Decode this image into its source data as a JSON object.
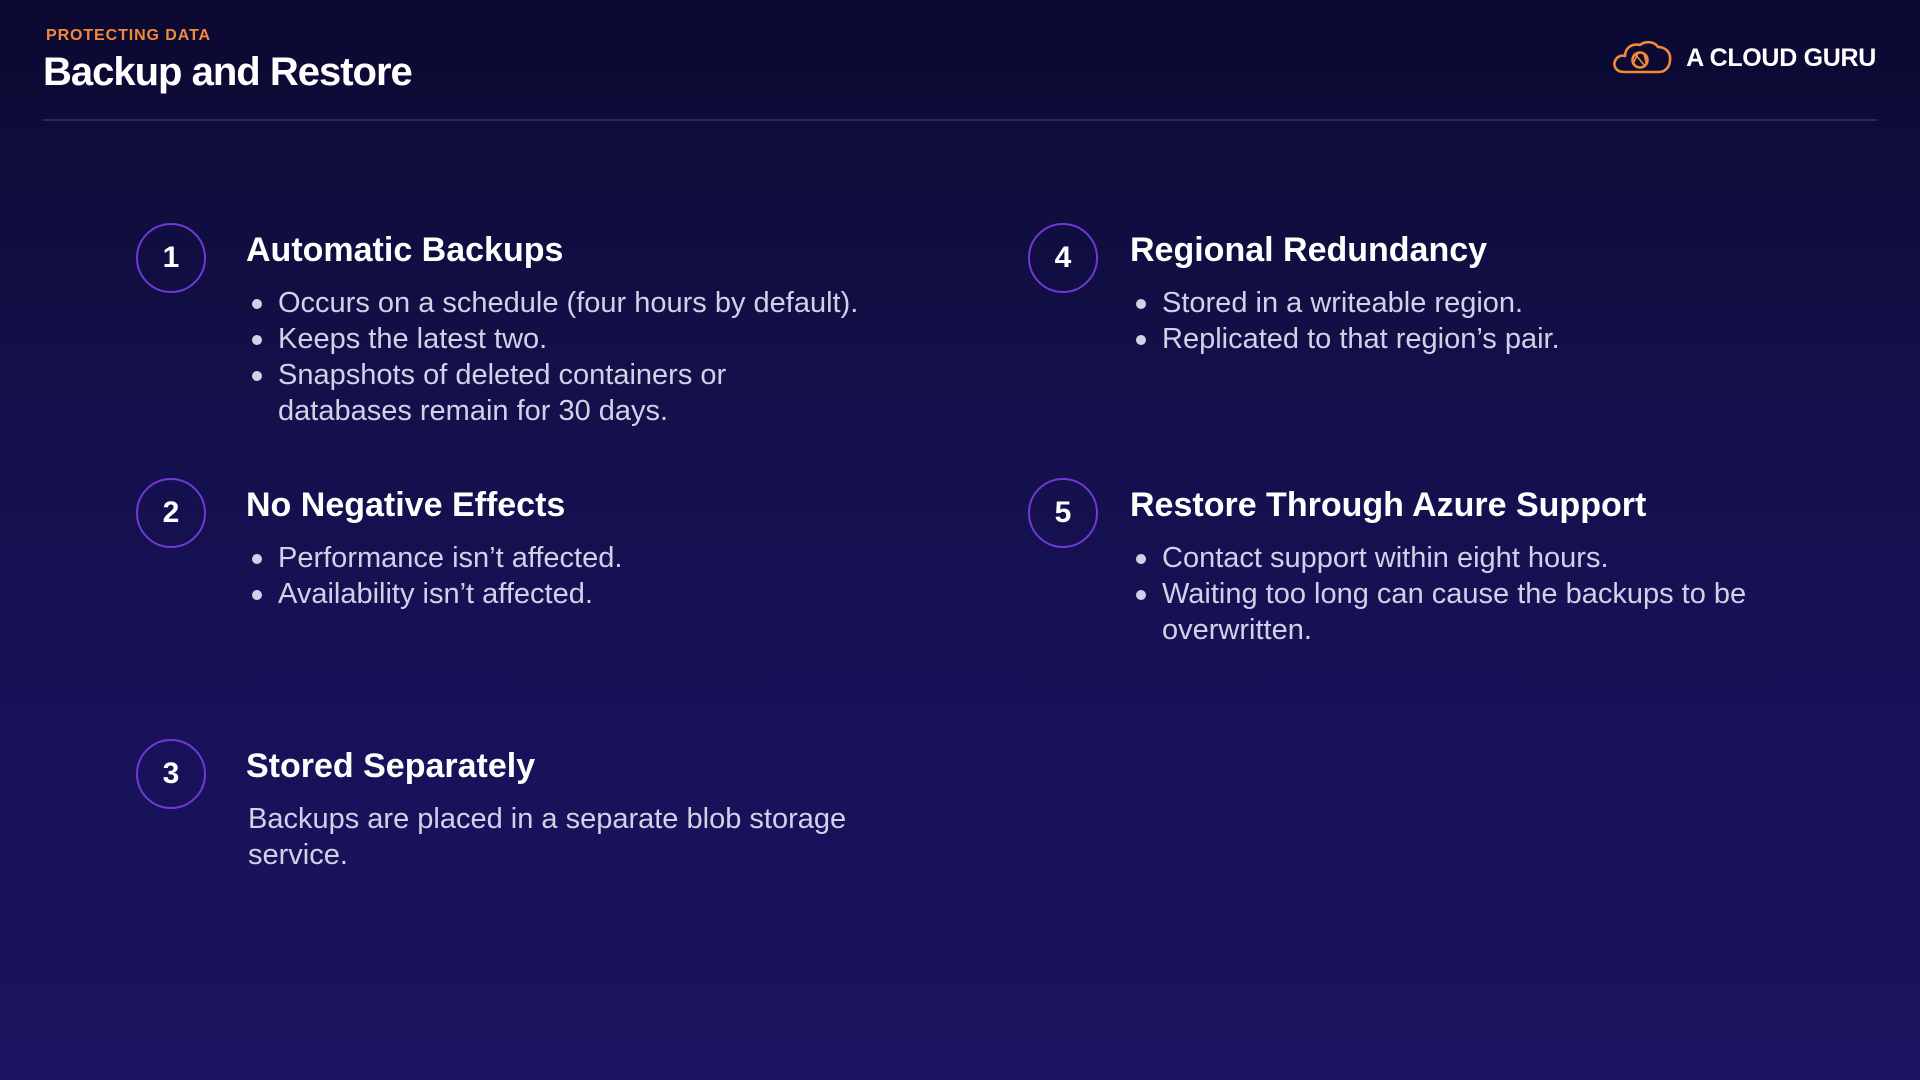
{
  "header": {
    "eyebrow": "PROTECTING DATA",
    "title": "Backup and Restore"
  },
  "brand": {
    "name": "A CLOUD GURU",
    "logo_icon": "cloud-icon",
    "logo_color": "#f28a3a"
  },
  "colors": {
    "background": "#13104a",
    "eyebrow": "#f28a3a",
    "circle_border": "#6f39d6",
    "body_text": "#d3d0e8"
  },
  "items": [
    {
      "number": "1",
      "title": "Automatic Backups",
      "bullets": [
        "Occurs on a schedule (four hours by default).",
        "Keeps the latest two.",
        "Snapshots of deleted containers or databases remain for 30 days."
      ]
    },
    {
      "number": "2",
      "title": "No Negative Effects",
      "bullets": [
        "Performance isn’t affected.",
        "Availability isn’t affected."
      ]
    },
    {
      "number": "3",
      "title": "Stored Separately",
      "text": "Backups are placed in a separate blob storage service."
    },
    {
      "number": "4",
      "title": "Regional Redundancy",
      "bullets": [
        "Stored in a writeable region.",
        "Replicated to that region’s pair."
      ]
    },
    {
      "number": "5",
      "title": "Restore Through Azure Support",
      "bullets": [
        "Contact support within eight hours.",
        "Waiting too long can cause the backups to be overwritten."
      ]
    }
  ]
}
